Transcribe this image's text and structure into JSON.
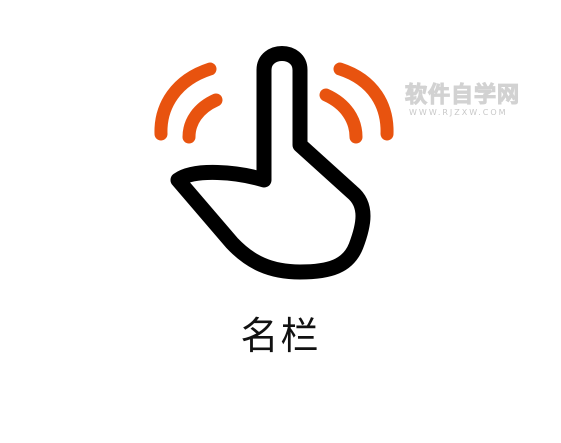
{
  "icon": {
    "name": "tap-gesture-icon",
    "hand_color": "#000000",
    "wave_color": "#e8530f"
  },
  "watermark": {
    "main_text": "软件自学网",
    "sub_text": "WWW.RJZXW.COM",
    "color": "#d2d2d2"
  },
  "caption": {
    "text": "名栏"
  }
}
